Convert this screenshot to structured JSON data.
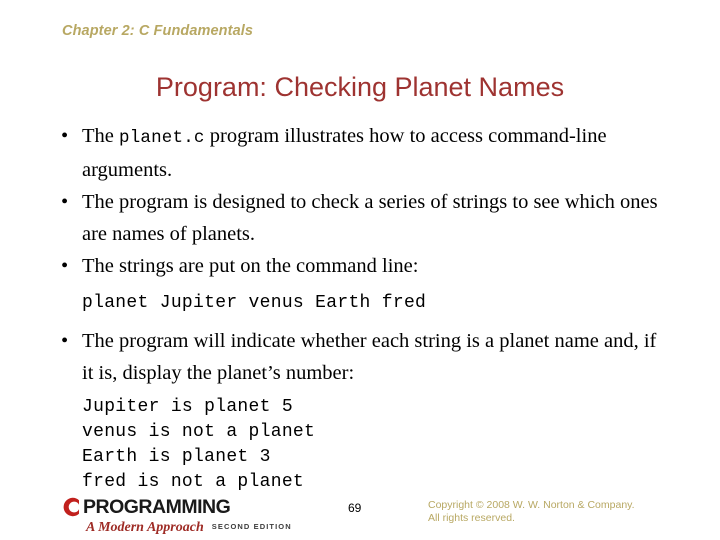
{
  "slide": {
    "chapter_header": "Chapter 2: C Fundamentals",
    "title": "Program: Checking Planet Names",
    "bullets": [
      {
        "id": "bullet-1",
        "parts": [
          {
            "type": "text",
            "value": "The "
          },
          {
            "type": "code",
            "value": "planet.c"
          },
          {
            "type": "text",
            "value": " program illustrates how to access command-line arguments."
          }
        ],
        "plain": "The planet.c program illustrates how to access command-line arguments."
      },
      {
        "id": "bullet-2",
        "parts": [
          {
            "type": "text",
            "value": "The program is designed to check a series of strings to see which ones are names of planets."
          }
        ],
        "plain": "The program is designed to check a series of strings to see which ones are names of planets."
      },
      {
        "id": "bullet-3",
        "parts": [
          {
            "type": "text",
            "value": "The strings are put on the command line:"
          }
        ],
        "plain": "The strings are put on the command line:"
      },
      {
        "id": "bullet-4",
        "parts": [
          {
            "type": "text",
            "value": "The program will indicate whether each string is a planet name and, if it is, display the planet’s number:"
          }
        ],
        "plain": "The program will indicate whether each string is a planet name and, if it is, display the planet’s number:"
      }
    ],
    "command_line": "planet Jupiter venus Earth fred",
    "program_output": "Jupiter is planet 5\nvenus is not a planet\nEarth is planet 3\nfred is not a planet",
    "output_lines": [
      "Jupiter is planet 5",
      "venus is not a planet",
      "Earth is planet 3",
      "fred is not a planet"
    ]
  },
  "footer": {
    "logo": {
      "mark_letter": "C",
      "wordmark": "PROGRAMMING",
      "subtitle": "A Modern Approach",
      "edition": "SECOND EDITION"
    },
    "page_number": "69",
    "copyright_line1": "Copyright © 2008 W. W. Norton & Company.",
    "copyright_line2": "All rights reserved."
  },
  "colors": {
    "title_red": "#9e3331",
    "eyebrow_olive": "#b8a863",
    "logo_red": "#c1201d",
    "logo_subtitle_red": "#9e2b25",
    "body_black": "#000000",
    "background": "#ffffff"
  }
}
